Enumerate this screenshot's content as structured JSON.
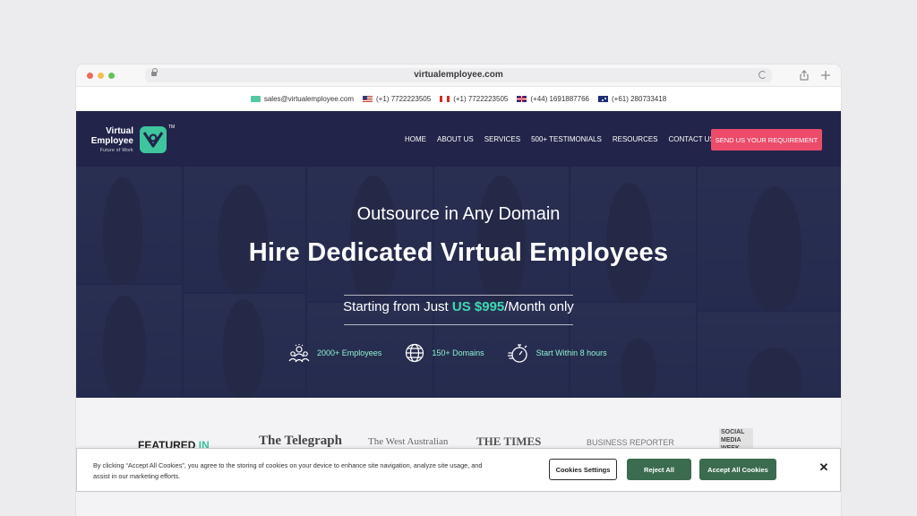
{
  "browser": {
    "url": "virtualemployee.com"
  },
  "contact_bar": {
    "email": "sales@virtualemployee.com",
    "phones": [
      {
        "flag": "us-flag-icon",
        "number": "(+1) 7722223505"
      },
      {
        "flag": "ca-flag-icon",
        "number": "(+1) 7722223505"
      },
      {
        "flag": "uk-flag-icon",
        "number": "(+44) 1691887766"
      },
      {
        "flag": "au-flag-icon",
        "number": "(+61) 280733418"
      }
    ]
  },
  "logo": {
    "line1": "Virtual",
    "line2": "Employee",
    "tagline": "Future of Work",
    "tm": "TM"
  },
  "nav": {
    "items": [
      "HOME",
      "ABOUT US",
      "SERVICES",
      "500+ TESTIMONIALS",
      "RESOURCES",
      "CONTACT US"
    ],
    "cta": "SEND US YOUR REQUIREMENT"
  },
  "hero": {
    "subtitle": "Outsource in Any Domain",
    "title": "Hire Dedicated Virtual Employees",
    "price_prefix": "Starting from Just ",
    "price_value": "US $995",
    "price_suffix": "/Month only",
    "stats": [
      {
        "icon": "team-icon",
        "label": "2000+ Employees"
      },
      {
        "icon": "globe-icon",
        "label": "150+ Domains"
      },
      {
        "icon": "stopwatch-icon",
        "label": "Start Within 8 hours"
      }
    ]
  },
  "featured": {
    "label": "FEATURED",
    "label_accent": "IN",
    "press": [
      "The Telegraph",
      "The West Australian",
      "THE TIMES",
      "BUSINESS REPORTER",
      "SOCIAL MEDIA WEEK"
    ]
  },
  "cookie": {
    "text": "By clicking “Accept All Cookies”, you agree to the storing of cookies on your device to enhance site navigation, analyze site usage, and assist in our marketing efforts.",
    "settings": "Cookies Settings",
    "reject": "Reject All",
    "accept": "Accept All Cookies",
    "close": "✕"
  },
  "colors": {
    "nav_bg": "#22244a",
    "accent_green": "#3ec59e",
    "cta_pink": "#ec4b6a",
    "cookie_button": "#3b6c4f"
  }
}
